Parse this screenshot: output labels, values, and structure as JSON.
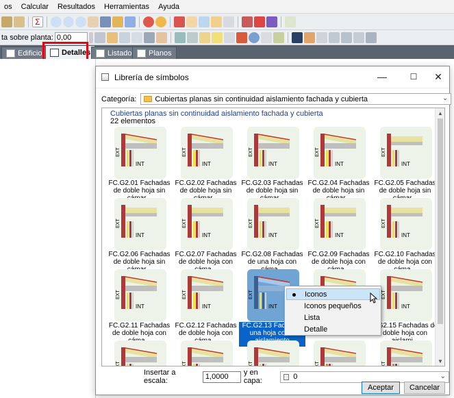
{
  "menu": [
    "os",
    "Calcular",
    "Resultados",
    "Herramientas",
    "Ayuda"
  ],
  "toolbar2": {
    "label": "ta sobre planta:",
    "value": "0,00"
  },
  "tabs": [
    {
      "label": "Edificio",
      "active": false
    },
    {
      "label": "Detalles",
      "active": true
    },
    {
      "label": "Listados",
      "active": false
    },
    {
      "label": "Planos",
      "active": false
    }
  ],
  "dialog": {
    "title": "Librería de símbolos",
    "category_label": "Categoría:",
    "category_value": "Cubiertas planas sin continuidad aislamiento fachada y cubierta",
    "list_header": "Cubiertas planas sin continuidad aislamiento fachada y cubierta",
    "list_count": "22 elementos",
    "thumb_labels": {
      "ext": "EXT",
      "int": "INT"
    },
    "items": [
      {
        "caption": "FC.G2.01 Fachadas de doble hoja sin cámar...",
        "variant": 1
      },
      {
        "caption": "FC.G2.02 Fachadas de doble hoja sin cámar...",
        "variant": 1
      },
      {
        "caption": "FC.G2.03 Fachadas de doble hoja sin cámar...",
        "variant": 1
      },
      {
        "caption": "FC.G2.04 Fachadas de doble hoja sin cámar...",
        "variant": 1
      },
      {
        "caption": "FC.G2.05 Fachadas de doble hoja sin cámar...",
        "variant": 2
      },
      {
        "caption": "FC.G2.06 Fachadas de doble hoja sin cámar...",
        "variant": 2
      },
      {
        "caption": "FC.G2.07 Fachadas de doble hoja con cáma...",
        "variant": 2
      },
      {
        "caption": "FC.G2.08 Fachadas de una hoja con cáma...",
        "variant": 2
      },
      {
        "caption": "FC.G2.09 Fachadas de doble hoja con cáma...",
        "variant": 2
      },
      {
        "caption": "FC.G2.10 Fachadas de doble hoja con cáma...",
        "variant": 2
      },
      {
        "caption": "FC.G2.11 Fachadas de doble hoja con cáma...",
        "variant": 1
      },
      {
        "caption": "FC.G2.12 Fachadas de doble hoja con cáma...",
        "variant": 1
      },
      {
        "caption": "FC.G2.13 Fachad... una hoja con... aislamiento",
        "variant": 3,
        "selected": true
      },
      {
        "caption": "",
        "variant": 1
      },
      {
        "caption": "...G2.15 Fachadas de doble hoja con aislami...",
        "variant": 1
      },
      {
        "caption": "",
        "variant": 1
      },
      {
        "caption": "",
        "variant": 1
      },
      {
        "caption": "",
        "variant": 1
      },
      {
        "caption": "",
        "variant": 4
      },
      {
        "caption": "",
        "variant": 4
      }
    ],
    "scale_label": "Insertar a escala:",
    "scale_value": "1,0000",
    "layer_label": "y en capa:",
    "layer_value": "0",
    "accept": "Aceptar",
    "cancel": "Cancelar"
  },
  "context_menu": {
    "items": [
      {
        "label": "Iconos",
        "checked": true,
        "highlighted": true
      },
      {
        "label": "Iconos pequeños",
        "checked": false
      },
      {
        "label": "Lista",
        "checked": false
      },
      {
        "label": "Detalle",
        "checked": false
      }
    ]
  },
  "colors": {
    "selection": "#0a64c8",
    "highlight_box": "#e30613",
    "folder": "#f3c24d"
  }
}
